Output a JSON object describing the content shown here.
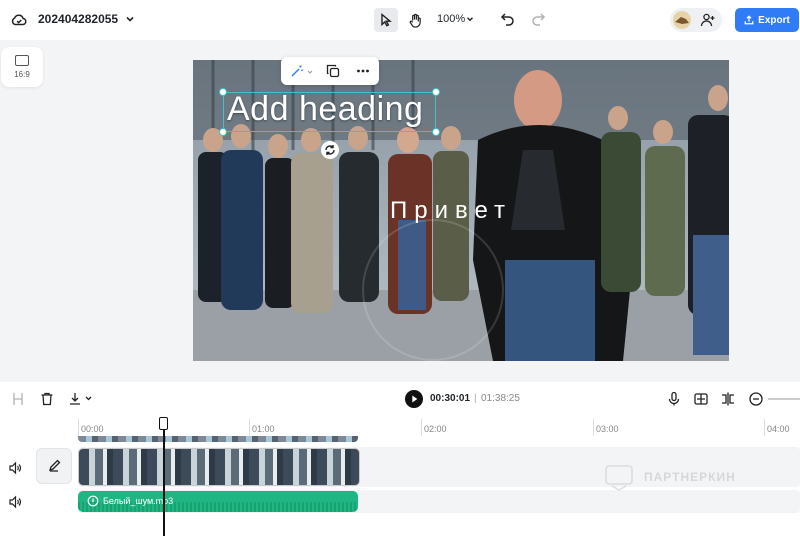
{
  "header": {
    "project_title": "202404282055",
    "zoom_level": "100%",
    "export_label": "Export"
  },
  "aspect_ratio": {
    "label": "16:9"
  },
  "canvas": {
    "heading_text": "Add heading",
    "caption_text": "Привет"
  },
  "player": {
    "current_time": "00:30:01",
    "separator": "|",
    "total_time": "01:38:25"
  },
  "timeline": {
    "ruler_labels": [
      "00:00",
      "01:00",
      "02:00",
      "03:00",
      "04:00"
    ],
    "audio_clip_name": "Белый_шум.mp3"
  },
  "watermark": {
    "text": "ПАРТНЕРКИН"
  },
  "colors": {
    "accent": "#2f7cf6",
    "selection": "#41c2c9",
    "audio_track": "#20b582"
  }
}
